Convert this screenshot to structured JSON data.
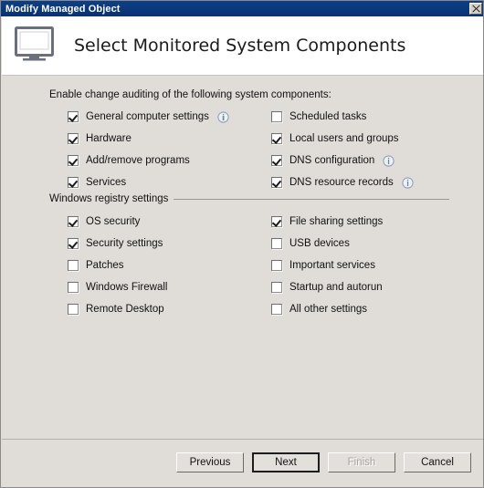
{
  "window": {
    "title": "Modify Managed Object",
    "close_icon": "close-icon"
  },
  "header": {
    "icon": "monitor-icon",
    "title": "Select Monitored System Components"
  },
  "sections": [
    {
      "label": "Enable change auditing of the following system components:",
      "has_rule": false,
      "left_items": [
        {
          "label": "General computer settings",
          "checked": true,
          "info": true
        },
        {
          "label": "Hardware",
          "checked": true,
          "info": false
        },
        {
          "label": "Add/remove programs",
          "checked": true,
          "info": false
        },
        {
          "label": "Services",
          "checked": true,
          "info": false
        }
      ],
      "right_items": [
        {
          "label": "Scheduled tasks",
          "checked": false,
          "info": false
        },
        {
          "label": "Local users and groups",
          "checked": true,
          "info": false
        },
        {
          "label": "DNS configuration",
          "checked": true,
          "info": true
        },
        {
          "label": "DNS resource records",
          "checked": true,
          "info": true
        }
      ]
    },
    {
      "label": "Windows registry settings",
      "has_rule": true,
      "left_items": [
        {
          "label": "OS security",
          "checked": true,
          "info": false
        },
        {
          "label": "Security settings",
          "checked": true,
          "info": false
        },
        {
          "label": "Patches",
          "checked": false,
          "info": false
        },
        {
          "label": "Windows Firewall",
          "checked": false,
          "info": false
        },
        {
          "label": "Remote Desktop",
          "checked": false,
          "info": false
        }
      ],
      "right_items": [
        {
          "label": "File sharing settings",
          "checked": true,
          "info": false
        },
        {
          "label": "USB devices",
          "checked": false,
          "info": false
        },
        {
          "label": "Important services",
          "checked": false,
          "info": false
        },
        {
          "label": "Startup and autorun",
          "checked": false,
          "info": false
        },
        {
          "label": "All other settings",
          "checked": false,
          "info": false
        }
      ]
    }
  ],
  "footer": {
    "buttons": [
      {
        "label": "Previous",
        "state": "normal"
      },
      {
        "label": "Next",
        "state": "default"
      },
      {
        "label": "Finish",
        "state": "disabled"
      },
      {
        "label": "Cancel",
        "state": "normal"
      }
    ]
  },
  "colors": {
    "titlebar": "#0b3d82",
    "body": "#e0ddd8",
    "header": "#ffffff",
    "info_icon": "#7d93ad"
  }
}
